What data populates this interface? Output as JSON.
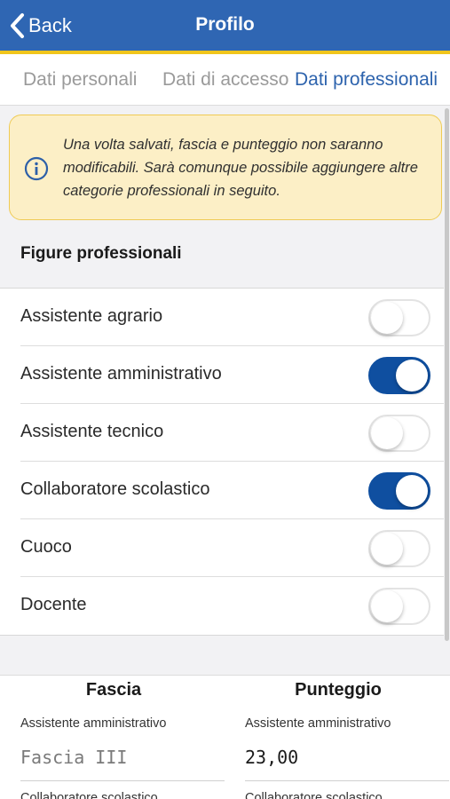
{
  "navbar": {
    "back_label": "Back",
    "title": "Profilo",
    "color": "#2f66b3",
    "accent": "#f0c51c"
  },
  "tabs": [
    {
      "label": "Dati personali",
      "active": false
    },
    {
      "label": "Dati di accesso",
      "active": false
    },
    {
      "label": "Dati professionali",
      "active": true
    }
  ],
  "notice": {
    "icon": "info-circle-icon",
    "text": "Una volta salvati, fascia e punteggio non saranno modificabili. Sarà comunque possibile aggiungere altre categorie professionali in seguito."
  },
  "section_title": "Figure professionali",
  "figures": [
    {
      "label": "Assistente agrario",
      "on": false
    },
    {
      "label": "Assistente amministrativo",
      "on": true
    },
    {
      "label": "Assistente tecnico",
      "on": false
    },
    {
      "label": "Collaboratore scolastico",
      "on": true
    },
    {
      "label": "Cuoco",
      "on": false
    },
    {
      "label": "Docente",
      "on": false
    }
  ],
  "toggle_on_color": "#0f4fa0",
  "results": {
    "fascia": {
      "title": "Fascia",
      "entries": [
        {
          "category": "Assistente amministrativo",
          "value": "Fascia III"
        },
        {
          "category": "Collaboratore scolastico"
        }
      ]
    },
    "punteggio": {
      "title": "Punteggio",
      "entries": [
        {
          "category": "Assistente amministrativo",
          "value": "23,00"
        },
        {
          "category": "Collaboratore scolastico"
        }
      ]
    }
  }
}
